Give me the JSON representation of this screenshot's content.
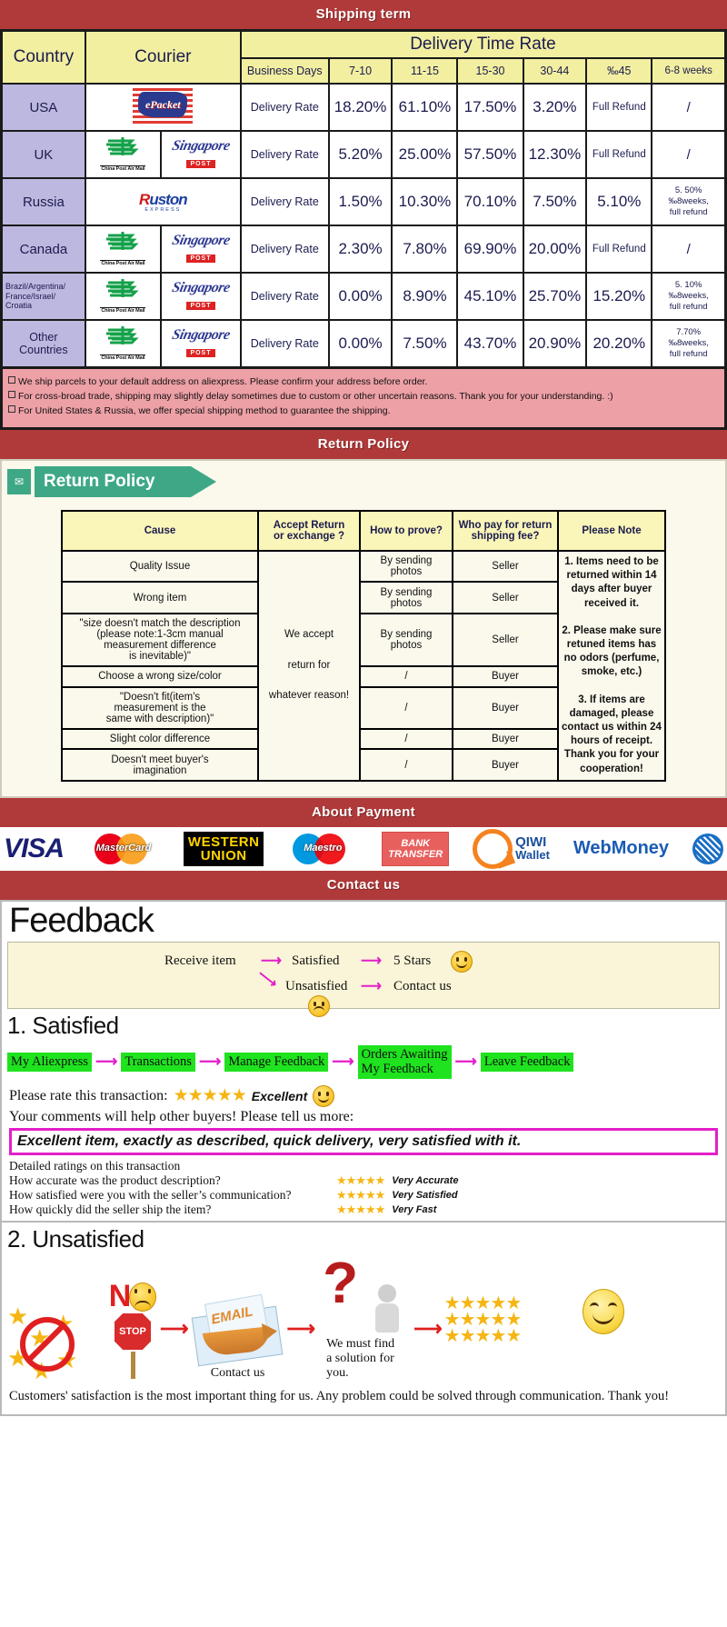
{
  "banners": {
    "shipping": "Shipping term",
    "return": "Return Policy",
    "payment": "About Payment",
    "contact": "Contact us"
  },
  "shipping": {
    "headers": {
      "country": "Country",
      "courier": "Courier",
      "delivery_time_rate": "Delivery Time Rate",
      "business_days": "Business Days",
      "ranges": [
        "7-10",
        "11-15",
        "15-30",
        "30-44",
        "‰45",
        "6-8 weeks"
      ]
    },
    "rate_label": "Delivery Rate",
    "rows": [
      {
        "country": "USA",
        "couriers": [
          "epacket"
        ],
        "values": [
          "18.20%",
          "61.10%",
          "17.50%",
          "3.20%",
          "Full Refund",
          "/"
        ]
      },
      {
        "country": "UK",
        "couriers": [
          "china-post-air-mail",
          "singapore-post"
        ],
        "values": [
          "5.20%",
          "25.00%",
          "57.50%",
          "12.30%",
          "Full Refund",
          "/"
        ]
      },
      {
        "country": "Russia",
        "couriers": [
          "ruston-express"
        ],
        "values": [
          "1.50%",
          "10.30%",
          "70.10%",
          "7.50%",
          "5.10%",
          "5. 50%\n‰8weeks,\nfull  refund"
        ]
      },
      {
        "country": "Canada",
        "couriers": [
          "china-post-air-mail",
          "singapore-post"
        ],
        "values": [
          "2.30%",
          "7.80%",
          "69.90%",
          "20.00%",
          "Full Refund",
          "/"
        ]
      },
      {
        "country": "Brazil/Argentina/\nFrance/Israel/\nCroatia",
        "couriers": [
          "china-post-air-mail",
          "singapore-post"
        ],
        "values": [
          "0.00%",
          "8.90%",
          "45.10%",
          "25.70%",
          "15.20%",
          "5. 10%\n‰8weeks,\nfull  refund"
        ]
      },
      {
        "country": "Other Countries",
        "couriers": [
          "china-post-air-mail",
          "singapore-post"
        ],
        "values": [
          "0.00%",
          "7.50%",
          "43.70%",
          "20.90%",
          "20.20%",
          "7.70%\n‰8weeks,\nfull  refund"
        ]
      }
    ],
    "notes": [
      "We ship parcels to your default address on aliexpress. Please confirm your address before order.",
      "For cross-broad trade, shipping may slightly delay sometimes due to custom or other uncertain reasons. Thank you for your understanding. :)",
      "For United States & Russia, we offer special shipping method to guarantee the shipping."
    ]
  },
  "courier_logos": {
    "epacket": "ePacket",
    "china_post": "China Post Air Mail",
    "singapore_post_word": "Singapore",
    "singapore_post_badge": "POST",
    "ruston_r": "R",
    "ruston_rest": "uston",
    "ruston_sub": "EXPRESS"
  },
  "return_policy": {
    "tab_label": "Return Policy",
    "tab_icon": "mail-icon",
    "headers": [
      "Cause",
      "Accept Return\nor exchange ?",
      "How to prove?",
      "Who pay for return\nshipping fee?",
      "Please Note"
    ],
    "accept_cell": "We accept\nreturn for\nwhatever reason!",
    "rows": [
      {
        "cause": "Quality Issue",
        "prove": "By sending\nphotos",
        "pay": "Seller"
      },
      {
        "cause": "Wrong item",
        "prove": "By sending\nphotos",
        "pay": "Seller"
      },
      {
        "cause": "\"size doesn't match the description\n(please note:1-3cm manual\nmeasurement difference\nis inevitable)\"",
        "prove": "By sending\nphotos",
        "pay": "Seller"
      },
      {
        "cause": "Choose a wrong size/color",
        "prove": "/",
        "pay": "Buyer"
      },
      {
        "cause": "\"Doesn't fit(item's\nmeasurement is the\nsame with description)\"",
        "prove": "/",
        "pay": "Buyer"
      },
      {
        "cause": "Slight color difference",
        "prove": "/",
        "pay": "Buyer"
      },
      {
        "cause": "Doesn't meet buyer's\nimagination",
        "prove": "/",
        "pay": "Buyer"
      }
    ],
    "note": "1. Items need to be returned within 14 days after buyer received it.\n\n2. Please make sure retuned items has no odors (perfume, smoke, etc.)\n\n3. If items are damaged, please contact us within 24 hours of receipt.\nThank you for your cooperation!"
  },
  "payment": {
    "methods": [
      {
        "name": "visa",
        "label": "VISA"
      },
      {
        "name": "mastercard",
        "label": "MasterCard"
      },
      {
        "name": "western-union",
        "line1": "WESTERN",
        "line2": "UNION"
      },
      {
        "name": "maestro",
        "label": "Maestro"
      },
      {
        "name": "bank-transfer",
        "line1": "BANK",
        "line2": "TRANSFER"
      },
      {
        "name": "qiwi-wallet",
        "line1": "QIWI",
        "line2": "Wallet"
      },
      {
        "name": "webmoney",
        "label": "WebMoney"
      },
      {
        "name": "yandex-money",
        "label": ""
      }
    ]
  },
  "feedback": {
    "title": "Feedback",
    "flow": {
      "receive": "Receive item",
      "satisfied": "Satisfied",
      "five_stars": "5 Stars",
      "unsatisfied": "Unsatisfied",
      "contact": "Contact us"
    },
    "satisfied": {
      "heading": "1. Satisfied",
      "steps": [
        "My Aliexpress",
        "Transactions",
        "Manage Feedback",
        "Orders Awaiting\nMy Feedback",
        "Leave Feedback"
      ],
      "rate_prompt": "Please rate this transaction:",
      "rate_word": "Excellent",
      "stars": "★★★★★",
      "comment_prompt": "Your comments will help other buyers! Please tell us more:",
      "quote": "Excellent item, exactly as described, quick delivery, very satisfied with it.",
      "detailed_title": "Detailed ratings on this transaction",
      "detailed": [
        {
          "question": "How accurate was the product description?",
          "stars": "★★★★★",
          "label": "Very Accurate"
        },
        {
          "question": "How satisfied were you with the seller’s communication?",
          "stars": "★★★★★",
          "label": "Very Satisfied"
        },
        {
          "question": "How quickly did the seller ship the item?",
          "stars": "★★★★★",
          "label": "Very Fast"
        }
      ]
    },
    "unsatisfied": {
      "heading": "2. Unsatisfied",
      "no_label": "N",
      "stop_label": "STOP",
      "email_label": "EMAIL",
      "contact_caption": "Contact us",
      "solution_caption": "We must find\na solution for\nyou.",
      "question_mark": "?"
    },
    "closing": "Customers' satisfaction is the most important thing for us. Any problem could be solved through communication. Thank you!"
  },
  "colors": {
    "banner_red": "#b0393a",
    "table_yellow": "#f2efa0",
    "country_lavender": "#bdb8df",
    "note_pink": "#eda0a6",
    "return_teal": "#3ea886",
    "step_green": "#1ee31e",
    "magenta": "#e31fc8",
    "star_gold": "#f5b513"
  }
}
